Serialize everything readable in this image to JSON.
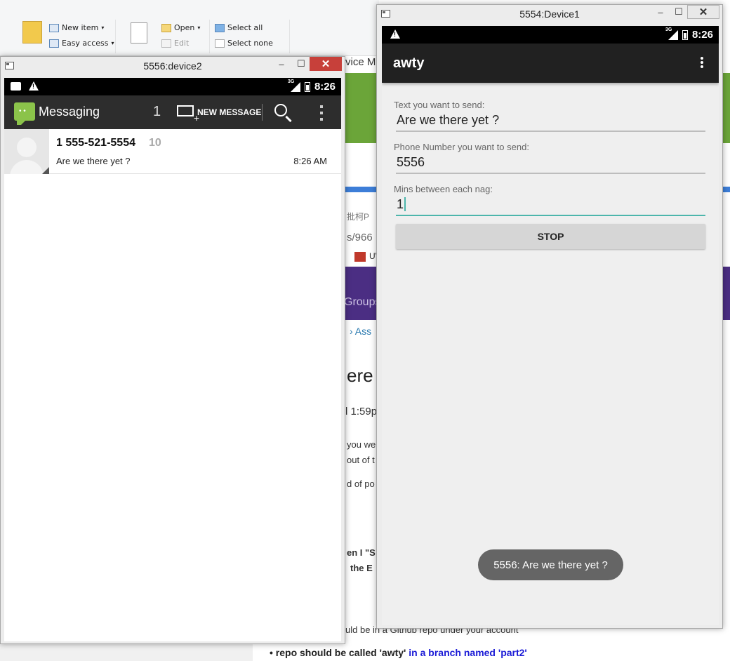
{
  "explorer_ribbon": {
    "new_item": "New item",
    "easy_access": "Easy access",
    "open": "Open",
    "edit": "Edit",
    "select_all": "Select all",
    "select_none": "Select none"
  },
  "background_page": {
    "title_fragment": "vice M",
    "cjk_fragment": "批柯P",
    "url_fragment": "s/966",
    "bookmark_fragment": "UV",
    "groups": "Groups",
    "breadcrumb": "Ass",
    "heading_fragment": "ere",
    "time_fragment": "l 1:59p",
    "line1": "you we",
    "line2": "out of t",
    "line3": "d of po",
    "bold1": "en I \"S",
    "bold2": "the E",
    "repo_fragment": "uld be in a Github repo under your account",
    "bullet_bold": "repo should be called 'awty'",
    "bullet_link": " in a branch named 'part2'"
  },
  "device2": {
    "window_title": "5556:device2",
    "status_time": "8:26",
    "signal_label": "3G",
    "actionbar_title": "Messaging",
    "unread_count": "1",
    "new_message_label": "NEW MESSAGE",
    "conversation": {
      "name": "1 555-521-5554",
      "count": "10",
      "snippet": "Are we there yet ?",
      "time": "8:26 AM"
    }
  },
  "device1": {
    "window_title": "5554:Device1",
    "status_time": "8:26",
    "signal_label": "3G",
    "app_title": "awty",
    "text_label": "Text you want to send:",
    "text_value": "Are we there yet ?",
    "phone_label": "Phone Number you want to send:",
    "phone_value": "5556",
    "mins_label": "Mins between each nag:",
    "mins_value": "1",
    "stop_label": "STOP",
    "toast": "5556: Are we there yet ?"
  },
  "colors": {
    "android_status_bar": "#000000",
    "messaging_actionbar": "#2d2d2d",
    "awty_actionbar": "#212121",
    "focus_accent": "#4db6ac",
    "close_button": "#c7403a",
    "toast_bg": "#656565"
  }
}
